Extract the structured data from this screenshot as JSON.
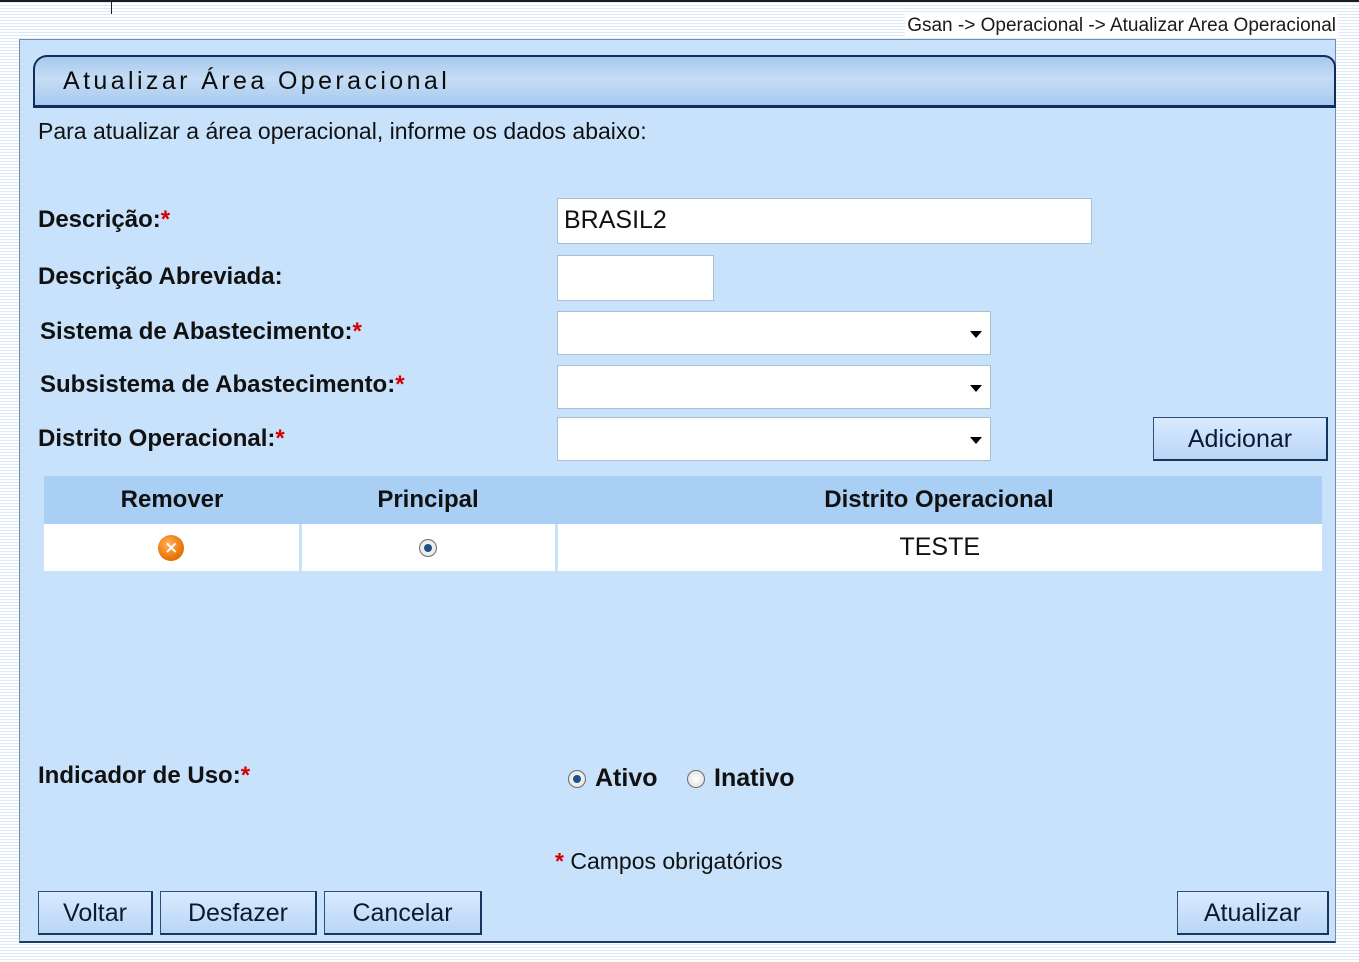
{
  "breadcrumb": "Gsan -> Operacional -> Atualizar Area Operacional",
  "title": "Atualizar Área Operacional",
  "intro": "Para atualizar a área operacional, informe os dados abaixo:",
  "required_mark": "*",
  "form": {
    "descricao_label": "Descrição:",
    "descricao_value": "BRASIL2",
    "descricao_abreviada_label": "Descrição Abreviada:",
    "descricao_abreviada_value": "",
    "sistema_label": "Sistema de Abastecimento:",
    "sistema_value": "",
    "subsistema_label": "Subsistema de Abastecimento:",
    "subsistema_value": "",
    "distrito_label": "Distrito Operacional:",
    "distrito_value": "",
    "adicionar_label": "Adicionar"
  },
  "table": {
    "headers": [
      "Remover",
      "Principal",
      "Distrito Operacional"
    ],
    "rows": [
      {
        "remover_icon": "remove-icon",
        "principal_selected": true,
        "distrito": "TESTE"
      }
    ]
  },
  "indicador_uso": {
    "label": "Indicador de Uso:",
    "options": [
      {
        "label": "Ativo",
        "selected": true
      },
      {
        "label": "Inativo",
        "selected": false
      }
    ]
  },
  "required_note": "Campos obrigatórios",
  "buttons": {
    "voltar": "Voltar",
    "desfazer": "Desfazer",
    "cancelar": "Cancelar",
    "atualizar": "Atualizar"
  },
  "colors": {
    "panel_bg": "#c9e2fb",
    "title_border": "#0f2f5a",
    "table_header_bg": "#a9cff4",
    "required": "#d40000",
    "remove_icon": "#ef7b10"
  }
}
